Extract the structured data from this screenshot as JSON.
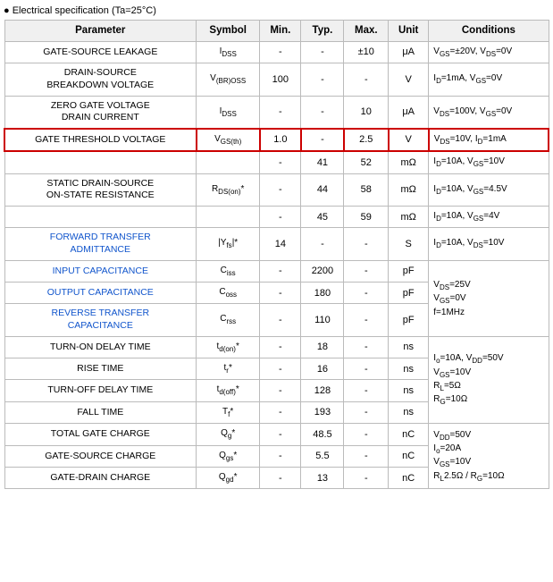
{
  "section_title": "● Electrical specification (Ta=25°C)",
  "table": {
    "headers": [
      "Parameter",
      "Symbol",
      "Min.",
      "Typ.",
      "Max.",
      "Unit",
      "Conditions"
    ],
    "rows": [
      {
        "id": "gate-source-leakage",
        "param": "GATE-SOURCE LEAKAGE",
        "param_blue": false,
        "symbol": "I<sub>DSS</sub>",
        "symbol_raw": "Ioss",
        "min": "-",
        "typ": "-",
        "max": "±10",
        "unit": "μA",
        "conditions": "V<sub>GS</sub>=±20V, V<sub>DS</sub>=0V",
        "highlight": false,
        "rowspan_conditions": 1
      },
      {
        "id": "drain-source-breakdown",
        "param": "DRAIN-SOURCE\nBREAKDOWN VOLTAGE",
        "param_blue": false,
        "symbol": "V<sub>(BR)OSS</sub>",
        "symbol_raw": "V(BR)OSS",
        "min": "100",
        "typ": "-",
        "max": "-",
        "unit": "V",
        "conditions": "I<sub>D</sub>=1mA, V<sub>GS</sub>=0V",
        "highlight": false,
        "rowspan_conditions": 1
      },
      {
        "id": "zero-gate-drain-current",
        "param": "ZERO GATE VOLTAGE\nDRAIN CURRENT",
        "param_blue": false,
        "symbol": "I<sub>DSS</sub>",
        "symbol_raw": "IDSS",
        "min": "-",
        "typ": "-",
        "max": "10",
        "unit": "μA",
        "conditions": "V<sub>DS</sub>=100V, V<sub>GS</sub>=0V",
        "highlight": false,
        "rowspan_conditions": 1
      },
      {
        "id": "gate-threshold-voltage",
        "param": "GATE THRESHOLD VOLTAGE",
        "param_blue": false,
        "symbol": "V<sub>GS(th)</sub>",
        "symbol_raw": "VGS(th)",
        "min": "1.0",
        "typ": "-",
        "max": "2.5",
        "unit": "V",
        "conditions": "V<sub>DS</sub>=10V, I<sub>D</sub>=1mA",
        "highlight": true,
        "rowspan_conditions": 1
      },
      {
        "id": "static-drain-source-1",
        "param": "",
        "param_blue": false,
        "symbol": "",
        "symbol_raw": "",
        "min": "-",
        "typ": "41",
        "max": "52",
        "unit": "mΩ",
        "conditions": "I<sub>D</sub>=10A, V<sub>GS</sub>=10V",
        "highlight": false,
        "rowspan_conditions": 1,
        "is_subrow": true
      },
      {
        "id": "static-drain-source-main",
        "param": "STATIC DRAIN-SOURCE\nON-STATE RESISTANCE",
        "param_blue": false,
        "symbol": "R<sub>DS(on)</sub>*",
        "symbol_raw": "RDS(on)*",
        "min": "-",
        "typ": "44",
        "max": "58",
        "unit": "mΩ",
        "conditions": "I<sub>D</sub>=10A, V<sub>GS</sub>=4.5V",
        "highlight": false,
        "rowspan_conditions": 1
      },
      {
        "id": "static-drain-source-3",
        "param": "",
        "param_blue": false,
        "symbol": "",
        "symbol_raw": "",
        "min": "-",
        "typ": "45",
        "max": "59",
        "unit": "mΩ",
        "conditions": "I<sub>D</sub>=10A, V<sub>GS</sub>=4V",
        "highlight": false,
        "rowspan_conditions": 1,
        "is_subrow": true
      },
      {
        "id": "forward-transfer-admittance",
        "param": "FORWARD TRANSFER\nADMITTANCE",
        "param_blue": true,
        "symbol": "|Y<sub>fs</sub>|*",
        "symbol_raw": "|Yfs|*",
        "min": "14",
        "typ": "-",
        "max": "-",
        "unit": "S",
        "conditions": "I<sub>D</sub>=10A, V<sub>DS</sub>=10V",
        "highlight": false,
        "rowspan_conditions": 1
      },
      {
        "id": "input-capacitance",
        "param": "INPUT CAPACITANCE",
        "param_blue": true,
        "symbol": "C<sub>iss</sub>",
        "symbol_raw": "Ciss",
        "min": "-",
        "typ": "2200",
        "max": "-",
        "unit": "pF",
        "conditions": "",
        "highlight": false,
        "rowspan_conditions": 3
      },
      {
        "id": "output-capacitance",
        "param": "OUTPUT CAPACITANCE",
        "param_blue": true,
        "symbol": "C<sub>oss</sub>",
        "symbol_raw": "Coss",
        "min": "-",
        "typ": "180",
        "max": "-",
        "unit": "pF",
        "conditions": "",
        "highlight": false,
        "rowspan_conditions": 0
      },
      {
        "id": "reverse-transfer-capacitance",
        "param": "REVERSE TRANSFER\nCAPACITANCE",
        "param_blue": true,
        "symbol": "C<sub>rss</sub>",
        "symbol_raw": "Crss",
        "min": "-",
        "typ": "110",
        "max": "-",
        "unit": "pF",
        "conditions": "",
        "highlight": false,
        "rowspan_conditions": 0
      },
      {
        "id": "turn-on-delay",
        "param": "TURN-ON DELAY TIME",
        "param_blue": false,
        "symbol": "t<sub>d(on)</sub>*",
        "symbol_raw": "td(on)*",
        "min": "-",
        "typ": "18",
        "max": "-",
        "unit": "ns",
        "conditions": "",
        "highlight": false,
        "rowspan_conditions": 4
      },
      {
        "id": "rise-time",
        "param": "RISE TIME",
        "param_blue": false,
        "symbol": "t<sub>r</sub>*",
        "symbol_raw": "tr*",
        "min": "-",
        "typ": "16",
        "max": "-",
        "unit": "ns",
        "conditions": "",
        "highlight": false,
        "rowspan_conditions": 0
      },
      {
        "id": "turn-off-delay",
        "param": "TURN-OFF DELAY TIME",
        "param_blue": false,
        "symbol": "t<sub>d(off)</sub>*",
        "symbol_raw": "td(off)*",
        "min": "-",
        "typ": "128",
        "max": "-",
        "unit": "ns",
        "conditions": "",
        "highlight": false,
        "rowspan_conditions": 0
      },
      {
        "id": "fall-time",
        "param": "FALL TIME",
        "param_blue": false,
        "symbol": "T<sub>f</sub>*",
        "symbol_raw": "Tf*",
        "min": "-",
        "typ": "193",
        "max": "-",
        "unit": "ns",
        "conditions": "",
        "highlight": false,
        "rowspan_conditions": 0
      },
      {
        "id": "total-gate-charge",
        "param": "TOTAL GATE CHARGE",
        "param_blue": false,
        "symbol": "Q<sub>g</sub>*",
        "symbol_raw": "Qg*",
        "min": "-",
        "typ": "48.5",
        "max": "-",
        "unit": "nC",
        "conditions": "",
        "highlight": false,
        "rowspan_conditions": 3
      },
      {
        "id": "gate-source-charge",
        "param": "GATE-SOURCE CHARGE",
        "param_blue": false,
        "symbol": "Q<sub>gs</sub>*",
        "symbol_raw": "Qgs*",
        "min": "-",
        "typ": "5.5",
        "max": "-",
        "unit": "nC",
        "conditions": "",
        "highlight": false,
        "rowspan_conditions": 0
      },
      {
        "id": "gate-drain-charge",
        "param": "GATE-DRAIN CHARGE",
        "param_blue": false,
        "symbol": "Q<sub>gd</sub>*",
        "symbol_raw": "Qgd*",
        "min": "-",
        "typ": "13",
        "max": "-",
        "unit": "nC",
        "conditions": "",
        "highlight": false,
        "rowspan_conditions": 0
      }
    ],
    "conditions_groups": {
      "capacitance": "V<sub>DS</sub>=25V<br>V<sub>GS</sub>=0V<br>f=1MHz",
      "switching": "I<sub>o</sub>=10A, V<sub>DD</sub>=50V<br>V<sub>GS</sub>=10V<br>R<sub>L</sub>=5Ω<br>R<sub>G</sub>=10Ω",
      "charge": "V<sub>DD</sub>=50V<br>I<sub>o</sub>=20A<br>V<sub>GS</sub>=10V<br>R<sub>L</sub>2.5Ω / R<sub>G</sub>=10Ω"
    }
  }
}
